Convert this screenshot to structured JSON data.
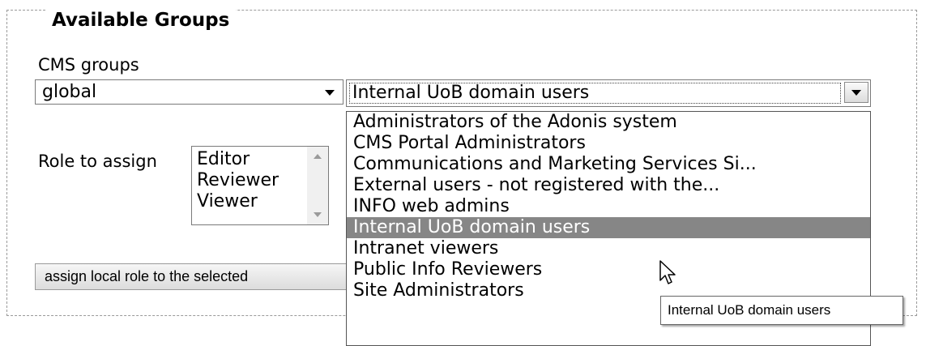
{
  "fieldset": {
    "legend": "Available Groups"
  },
  "cms_groups": {
    "label": "CMS groups",
    "scope_select": {
      "value": "global"
    },
    "group_select": {
      "value": "Internal UoB domain users",
      "options": [
        "Administrators of the Adonis system",
        "CMS Portal Administrators",
        "Communications and Marketing Services Si...",
        "External users - not registered with the...",
        "INFO web admins",
        "Internal UoB domain users",
        "Intranet viewers",
        "Public Info Reviewers",
        "Site Administrators"
      ],
      "selected_option": "Internal UoB domain users"
    }
  },
  "role": {
    "label": "Role to assign",
    "options": [
      "Editor",
      "Reviewer",
      "Viewer"
    ]
  },
  "assign_button": {
    "label": "assign local role to the selected"
  },
  "tooltip": {
    "text": "Internal UoB domain users"
  },
  "icons": {
    "dropdown_caret": "chevron-down-icon",
    "cursor": "mouse-pointer-icon",
    "scroll_up": "scroll-up-arrow-icon",
    "scroll_down": "scroll-down-arrow-icon"
  },
  "colors": {
    "selection_background": "#868686",
    "fieldset_border": "#9a9a9a"
  }
}
